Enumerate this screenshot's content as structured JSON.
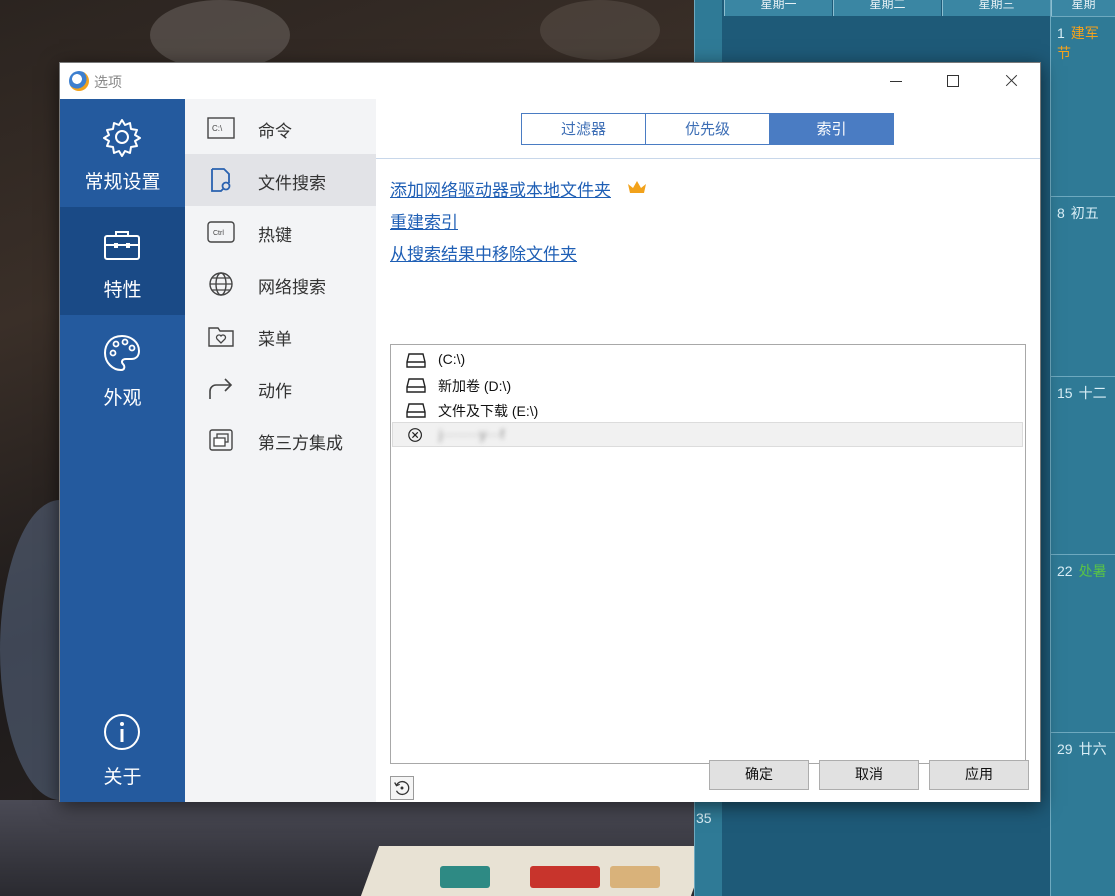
{
  "window": {
    "title": "选项"
  },
  "categories": [
    {
      "label": "常规设置",
      "icon": "gear-icon"
    },
    {
      "label": "特性",
      "icon": "toolbox-icon"
    },
    {
      "label": "外观",
      "icon": "palette-icon"
    },
    {
      "label": "关于",
      "icon": "info-icon"
    }
  ],
  "nav": [
    {
      "label": "命令",
      "icon": "command-prompt-icon"
    },
    {
      "label": "文件搜索",
      "icon": "file-search-icon"
    },
    {
      "label": "热键",
      "icon": "ctrl-key-icon",
      "key_text": "Ctrl"
    },
    {
      "label": "网络搜索",
      "icon": "globe-icon"
    },
    {
      "label": "菜单",
      "icon": "heart-folder-icon"
    },
    {
      "label": "动作",
      "icon": "share-arrow-icon"
    },
    {
      "label": "第三方集成",
      "icon": "windows-stack-icon"
    }
  ],
  "command_icon_text": "C:\\",
  "tabs": [
    {
      "label": "过滤器"
    },
    {
      "label": "优先级"
    },
    {
      "label": "索引"
    }
  ],
  "links": {
    "add_folder": "添加网络驱动器或本地文件夹",
    "rebuild": "重建索引",
    "remove": "从搜索结果中移除文件夹"
  },
  "index_list": [
    {
      "label": " (C:\\)",
      "icon": "drive-icon"
    },
    {
      "label": "新加卷 (D:\\)",
      "icon": "drive-icon"
    },
    {
      "label": "文件及下载 (E:\\)",
      "icon": "drive-icon"
    },
    {
      "label": "j········y···f",
      "icon": "excluded-circle-x-icon",
      "blurred": true
    }
  ],
  "buttons": {
    "ok": "确定",
    "cancel": "取消",
    "apply": "应用"
  },
  "calendar": {
    "headers": [
      "星期一",
      "星期二",
      "星期三",
      "星期"
    ],
    "cells": [
      {
        "day": "1",
        "lunar": "建军节"
      },
      {
        "day": "8",
        "lunar": "初五"
      },
      {
        "day": "15",
        "lunar": "十二"
      },
      {
        "day": "22",
        "lunar": "处暑"
      },
      {
        "day": "29",
        "lunar": "廿六"
      }
    ],
    "week_number": "35"
  },
  "colors": {
    "accent": "#245a9e",
    "accent_active": "#1a4a86",
    "tab_blue": "#4a7cc3",
    "link": "#1f5fb5",
    "crown": "#f2a21b"
  }
}
